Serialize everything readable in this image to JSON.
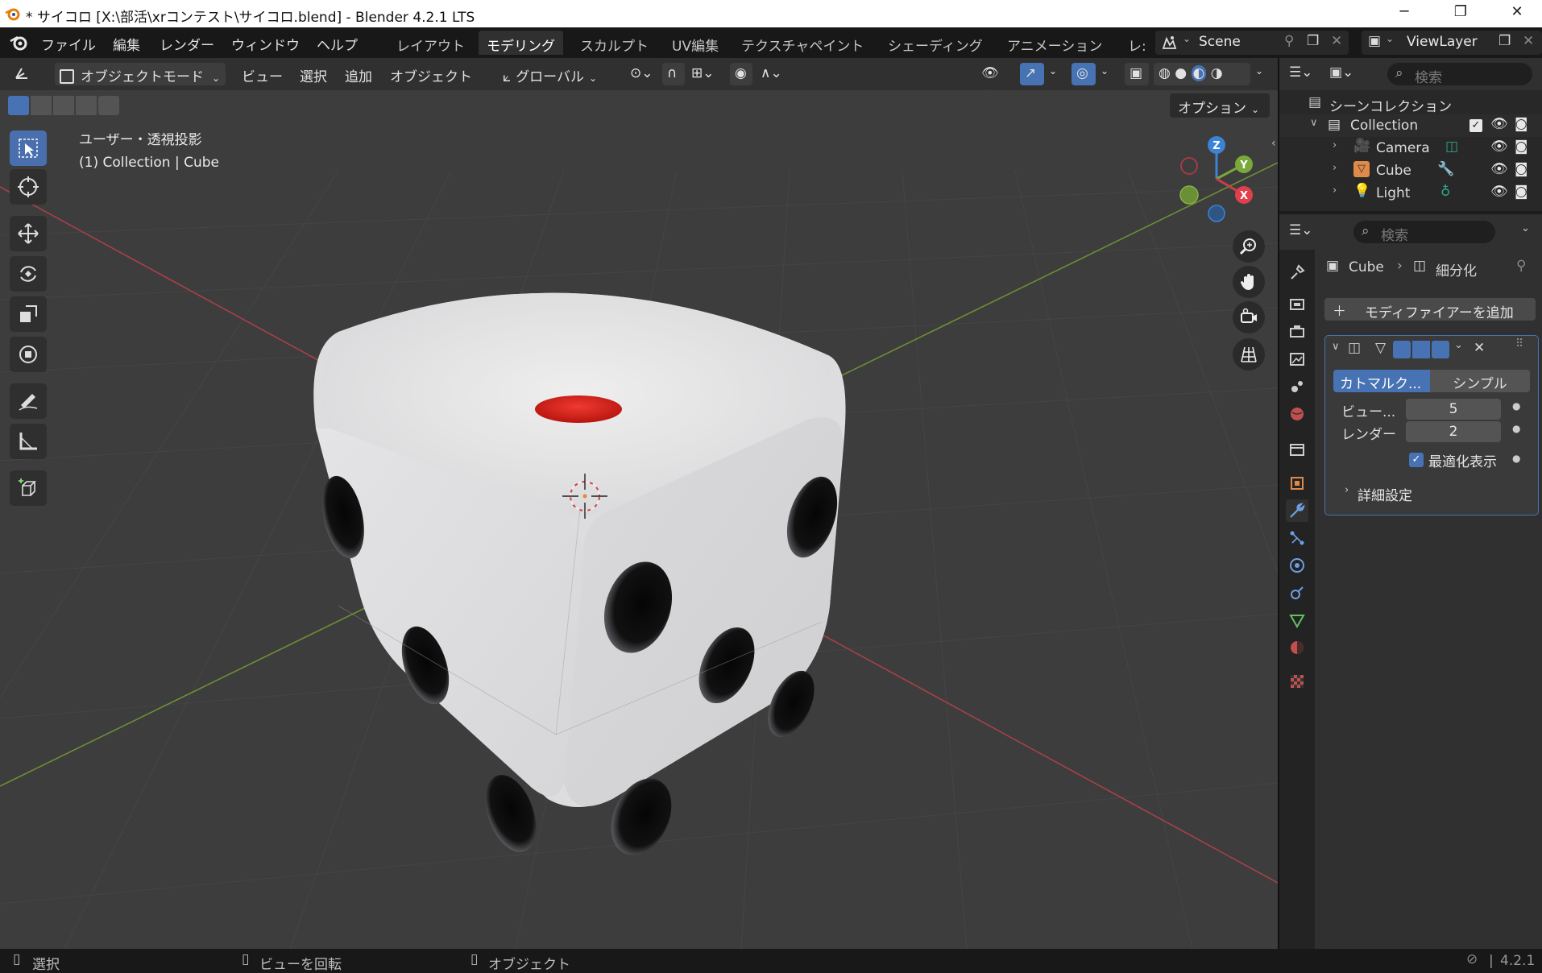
{
  "window": {
    "title": "* サイコロ [X:\\部活\\xrコンテスト\\サイコロ.blend] - Blender 4.2.1 LTS",
    "minimize": "─",
    "maximize": "❐",
    "close": "✕"
  },
  "menubar": {
    "items": [
      "ファイル",
      "編集",
      "レンダー",
      "ウィンドウ",
      "ヘルプ"
    ],
    "workspaces": [
      "レイアウト",
      "モデリング",
      "スカルプト",
      "UV編集",
      "テクスチャペイント",
      "シェーディング",
      "アニメーション",
      "レ:"
    ],
    "active_workspace": "モデリング",
    "scene": "Scene",
    "view_layer": "ViewLayer"
  },
  "viewport_header": {
    "mode": "オブジェクトモード",
    "menus": [
      "ビュー",
      "選択",
      "追加",
      "オブジェクト"
    ],
    "transform_orientation": "グローバル",
    "options": "オプション"
  },
  "viewport": {
    "view_name": "ユーザー・透視投影",
    "context": "(1) Collection | Cube",
    "gizmo": {
      "z": "Z",
      "y": "Y",
      "x": "X"
    }
  },
  "outliner": {
    "search_placeholder": "検索",
    "root": "シーンコレクション",
    "collection": "Collection",
    "objects": [
      {
        "name": "Camera",
        "color": "#e08a4a"
      },
      {
        "name": "Cube",
        "color": "#e08a4a"
      },
      {
        "name": "Light",
        "color": "#e08a4a"
      }
    ]
  },
  "properties": {
    "search_placeholder": "検索",
    "breadcrumb_object": "Cube",
    "breadcrumb_modifier": "細分化",
    "add_modifier": "モディファイアーを追加",
    "subdiv": {
      "type_catmull": "カトマルク...",
      "type_simple": "シンプル",
      "viewport_label": "ビュー...",
      "viewport_value": "5",
      "render_label": "レンダー",
      "render_value": "2",
      "optimal_display": "最適化表示",
      "optimal_display_checked": true,
      "advanced": "詳細設定"
    }
  },
  "statusbar": {
    "select": "選択",
    "rotate_view": "ビューを回転",
    "object": "オブジェクト",
    "version": "4.2.1"
  },
  "colors": {
    "accent": "#4772b3",
    "x_axis": "#c8404a",
    "y_axis": "#7aa83a",
    "z_axis": "#3b83d6",
    "dice_pip_one": "#d9211c"
  }
}
